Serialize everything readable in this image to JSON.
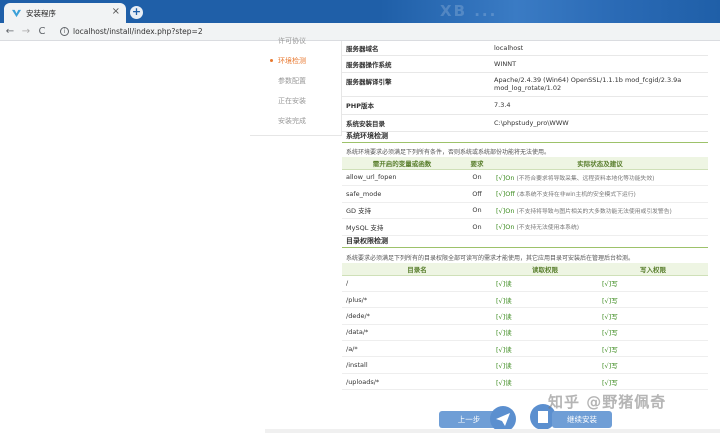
{
  "browser": {
    "tab_title": "安装程序",
    "tab_close": "×",
    "new_tab": "+",
    "nav_back": "←",
    "nav_forward": "→",
    "nav_reload": "C",
    "url": "localhost/install/index.php?step=2",
    "info": "i",
    "decor_text": "XB ..."
  },
  "sidebar": {
    "steps": [
      "许可协议",
      "环境检测",
      "参数配置",
      "正在安装",
      "安装完成"
    ],
    "active_index": 1
  },
  "server_info": [
    {
      "key": "服务器域名",
      "value": "localhost"
    },
    {
      "key": "服务器操作系统",
      "value": "WINNT"
    },
    {
      "key": "服务器解译引擎",
      "value": "Apache/2.4.39 (Win64) OpenSSL/1.1.1b mod_fcgid/2.3.9a",
      "value2": "mod_log_rotate/1.02"
    },
    {
      "key": "PHP版本",
      "value": "7.3.4"
    },
    {
      "key": "系统安装目录",
      "value": "C:\\phpstudy_pro\\WWW"
    }
  ],
  "env_check": {
    "title": "系统环境检测",
    "desc": "系统环境要求必须满足下列所有条件，否则系统或系统部份功能将无法使用。",
    "headers": [
      "需开启的变量或函数",
      "要求",
      "实际状态及建议"
    ],
    "rows": [
      {
        "name": "allow_url_fopen",
        "req": "On",
        "status": "[√]On",
        "note": "(不符合要求将导致采集、远程资料本地化等功能失效)"
      },
      {
        "name": "safe_mode",
        "req": "Off",
        "status": "[√]Off",
        "note": "(本系统不支持在非win主机的安全模式下运行)"
      },
      {
        "name": "GD 支持",
        "req": "On",
        "status": "[√]On",
        "note": "(不支持将导致与图片相关的大多数功能无法使用或引发警告)"
      },
      {
        "name": "MySQL 支持",
        "req": "On",
        "status": "[√]On",
        "note": "(不支持无法使用本系统)"
      }
    ]
  },
  "dir_check": {
    "title": "目录权限检测",
    "desc": "系统要求必须满足下列所有的目录权限全部可读写的需求才能使用，其它应用目录可安装后在管理后台检测。",
    "headers": [
      "目录名",
      "读取权限",
      "写入权限"
    ],
    "rows": [
      {
        "dir": "/",
        "read": "[√]读",
        "write": "[√]写"
      },
      {
        "dir": "/plus/*",
        "read": "[√]读",
        "write": "[√]写"
      },
      {
        "dir": "/dede/*",
        "read": "[√]读",
        "write": "[√]写"
      },
      {
        "dir": "/data/*",
        "read": "[√]读",
        "write": "[√]写"
      },
      {
        "dir": "/a/*",
        "read": "[√]读",
        "write": "[√]写"
      },
      {
        "dir": "/install",
        "read": "[√]读",
        "write": "[√]写"
      },
      {
        "dir": "/uploads/*",
        "read": "[√]读",
        "write": "[√]写"
      }
    ]
  },
  "buttons": {
    "prev": "上一步",
    "next": "继续安装"
  },
  "watermark": "知乎 @野猪佩奇",
  "colors": {
    "tab_bar": "#1f5fa8",
    "active_step": "#e8782f",
    "ok_green": "#3b8b1e",
    "button_blue": "#6f9ed6"
  }
}
